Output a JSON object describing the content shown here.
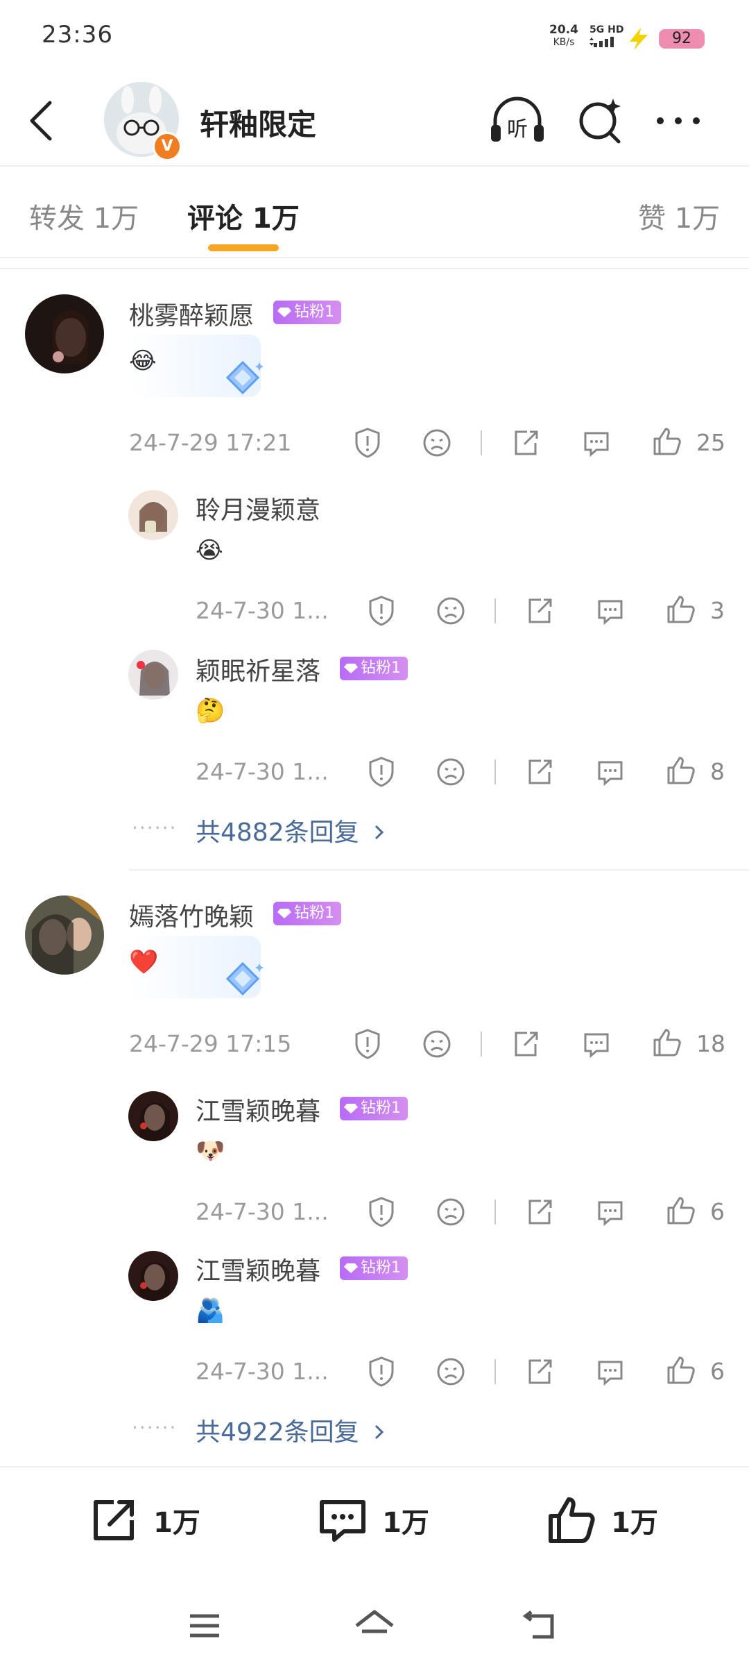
{
  "status": {
    "time": "23:36",
    "net_speed": "20.4",
    "net_unit": "KB/s",
    "network": "5G HD",
    "battery": "92"
  },
  "header": {
    "title": "轩釉限定",
    "verified_badge": "V",
    "listen_icon": "headphones-listen-icon",
    "listen_label": "听",
    "search_icon": "search-sparkle-icon",
    "more_icon": "more-icon"
  },
  "tabs": [
    {
      "label": "转发 1万"
    },
    {
      "label": "评论 1万",
      "active": true
    },
    {
      "label": "赞 1万"
    }
  ],
  "comments": [
    {
      "user": "桃雾醉颖愿",
      "badge": "钻粉1",
      "emoji": "😂",
      "date": "24-7-29 17:21",
      "likes": "25",
      "replies": [
        {
          "user": "聆月漫颖意",
          "badge": "",
          "emoji": "😭",
          "date": "24-7-30 1...",
          "likes": "3"
        },
        {
          "user": "颖眠祈星落",
          "badge": "钻粉1",
          "emoji": "🤔",
          "date": "24-7-30 1...",
          "likes": "8"
        }
      ],
      "more_replies": "共4882条回复",
      "more_dots": "······"
    },
    {
      "user": "嫣落竹晚颖",
      "badge": "钻粉1",
      "emoji": "❤️",
      "date": "24-7-29 17:15",
      "likes": "18",
      "replies": [
        {
          "user": "江雪颖晚暮",
          "badge": "钻粉1",
          "emoji": "🐶",
          "date": "24-7-30 1...",
          "likes": "6"
        },
        {
          "user": "江雪颖晚暮",
          "badge": "钻粉1",
          "emoji": "🫂",
          "date": "24-7-30 1...",
          "likes": "6"
        }
      ],
      "more_replies": "共4922条回复",
      "more_dots": "······"
    }
  ],
  "bottom_bar": {
    "repost": "1万",
    "comment": "1万",
    "like": "1万"
  },
  "colors": {
    "accent": "#f5a623",
    "link": "#4a6a9a",
    "badge": "#c47cf2",
    "battery": "#ee8db0",
    "verified": "#f07d1f"
  }
}
